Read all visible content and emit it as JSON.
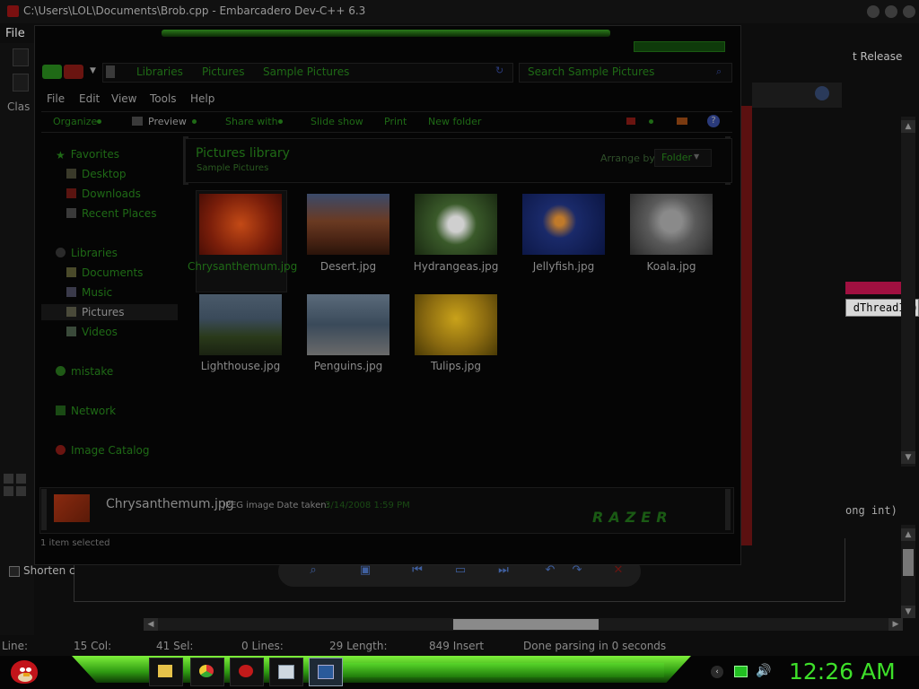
{
  "ide": {
    "title": "C:\\Users\\LOL\\Documents\\Brob.cpp - Embarcadero Dev-C++ 6.3",
    "menu_file": "File",
    "class_label": "Clas",
    "release": "t Release",
    "code_threadid": "dThreadId)",
    "code_longint": "ong int)",
    "shorten": "Shorten c",
    "status": {
      "line_label": "Line:",
      "col": "15 Col:",
      "sel": "41 Sel:",
      "lines": "0 Lines:",
      "length": "29 Length:",
      "insert": "849 Insert",
      "parsing": "Done parsing in 0 seconds"
    },
    "colors": {
      "editor_red": "#5a1010",
      "accent_pink": "#a01040"
    }
  },
  "explorer": {
    "breadcrumbs": [
      "Libraries",
      "Pictures",
      "Sample Pictures"
    ],
    "search_placeholder": "Search Sample Pictures",
    "menu": [
      "File",
      "Edit",
      "View",
      "Tools",
      "Help"
    ],
    "toolbar": {
      "organize": "Organize",
      "preview": "Preview",
      "share_with": "Share with",
      "slide_show": "Slide show",
      "print": "Print",
      "new_folder": "New folder"
    },
    "nav": {
      "favorites": "Favorites",
      "desktop": "Desktop",
      "downloads": "Downloads",
      "recent_places": "Recent Places",
      "libraries": "Libraries",
      "documents": "Documents",
      "music": "Music",
      "pictures": "Pictures",
      "videos": "Videos",
      "homegroup": "mistake",
      "network": "Network",
      "image_catalog": "Image Catalog"
    },
    "library": {
      "title": "Pictures library",
      "subtitle": "Sample Pictures",
      "arrange_label": "Arrange by:",
      "arrange_value": "Folder"
    },
    "files": [
      "Chrysanthemum.jpg",
      "Desert.jpg",
      "Hydrangeas.jpg",
      "Jellyfish.jpg",
      "Koala.jpg",
      "Lighthouse.jpg",
      "Penguins.jpg",
      "Tulips.jpg"
    ],
    "details": {
      "name": "Chrysanthemum.jpg",
      "type_and_label": "JPEG image Date taken:",
      "date_taken": "3/14/2008 1:59 PM"
    },
    "brand": "RAZER",
    "status": "1 item selected",
    "colors": {
      "accent_green": "#1f6a16"
    }
  },
  "taskbar": {
    "clock": "12:26 AM",
    "buttons": [
      "explorer-icon",
      "chrome-icon",
      "devcpp-icon",
      "window-icon",
      "window-active-icon"
    ],
    "colors": {
      "bar_green": "#4fd02a",
      "clock_green": "#3ee02a"
    }
  }
}
